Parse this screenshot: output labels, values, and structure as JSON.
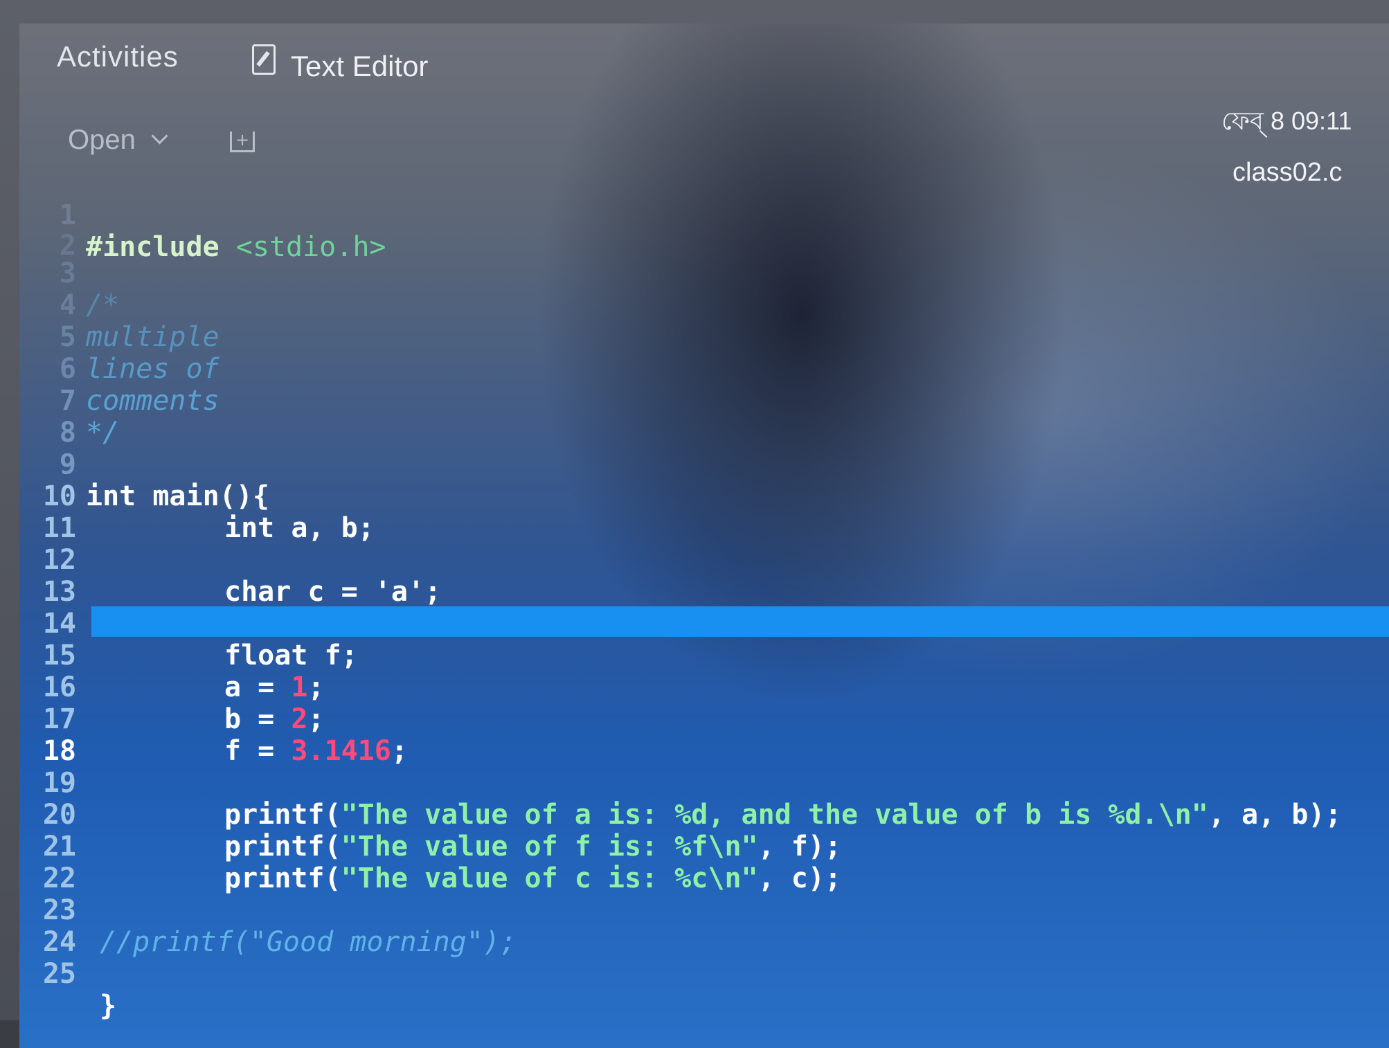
{
  "topbar": {
    "activities_label": "Activities",
    "app_icon": "text-editor-icon",
    "app_name": "Text Editor",
    "clock": "ফেব্ 8 09:11"
  },
  "toolbar": {
    "open_label": "Open",
    "open_icon": "chevron-down-icon",
    "new_tab_icon": "new-document-icon",
    "new_tab_symbol": "+"
  },
  "document": {
    "filename": "class02.c",
    "current_line": "18"
  },
  "code_lines": [
    {
      "num": "1",
      "text": "#include <stdio.h>"
    },
    {
      "num": "2",
      "text": ""
    },
    {
      "num": "3",
      "text": "/*"
    },
    {
      "num": "4",
      "text": "multiple"
    },
    {
      "num": "5",
      "text": "lines of"
    },
    {
      "num": "6",
      "text": "comments"
    },
    {
      "num": "7",
      "text": "*/"
    },
    {
      "num": "8",
      "text": ""
    },
    {
      "num": "9",
      "text": "int main(){"
    },
    {
      "num": "10",
      "text": "int a, b;"
    },
    {
      "num": "11",
      "text": ""
    },
    {
      "num": "12",
      "text": "char c = 'a';"
    },
    {
      "num": "13",
      "text": ""
    },
    {
      "num": "14",
      "text": "float f;"
    },
    {
      "num": "15",
      "text": "a = 1;"
    },
    {
      "num": "16",
      "text": "b = 2;"
    },
    {
      "num": "17",
      "text": "f = 3.1416;"
    },
    {
      "num": "18",
      "text": ""
    },
    {
      "num": "19",
      "text": "printf(\"The value of a is: %d, and the value of b is %d.\\n\", a, b);"
    },
    {
      "num": "20",
      "text": "printf(\"The value of f is: %f\\n\", f);"
    },
    {
      "num": "21",
      "text": "printf(\"The value of c is: %c\\n\", c);"
    },
    {
      "num": "22",
      "text": ""
    },
    {
      "num": "23",
      "text": "//printf(\"Good morning\");"
    },
    {
      "num": "24",
      "text": ""
    },
    {
      "num": "25",
      "text": "}"
    }
  ],
  "tokens": {
    "include_kw": "#include",
    "include_file": "<stdio.h>",
    "int_kw": "int",
    "main_sig": "main(){",
    "decl_ab": "a, b;",
    "char_kw": "char",
    "char_rest_a": "c = ",
    "char_lit": "'a'",
    "semi": ";",
    "float_kw": "float",
    "float_rest": "f;",
    "assign_a": "a = ",
    "assign_b": "b = ",
    "assign_f": "f = ",
    "num_1": "1",
    "num_2": "2",
    "num_3": "3.1416",
    "printf_open": "printf(",
    "fmt_a": "\"The value of a is: %d, and the value of b is %d.\\n\"",
    "args_ab": ", a, b);",
    "fmt_f": "\"The value of f is: %f\\n\"",
    "args_f": ", f);",
    "fmt_c": "\"The value of c is: %c\\n\"",
    "args_c": ", c);",
    "comment_printf": "//printf(\"Good morning\");",
    "close_brace": "}",
    "cmt_open": "/*",
    "cmt_l4": "multiple",
    "cmt_l5": "lines of",
    "cmt_l6": "comments",
    "cmt_close": "*/"
  },
  "colors": {
    "current_line_highlight": "#1890f2",
    "string": "#8ff0a8",
    "number": "#ff4a7a",
    "comment": "#5fb3e6"
  }
}
